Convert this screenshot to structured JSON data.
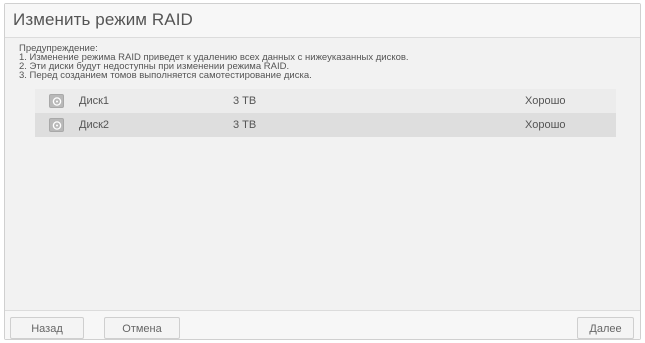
{
  "dialog": {
    "title": "Изменить режим RAID"
  },
  "warning": {
    "heading": "Предупреждение:",
    "lines": [
      "1. Изменение режима RAID приведет к удалению всех данных с нижеуказанных дисков.",
      "2. Эти диски будут недоступны при изменении режима RAID.",
      "3. Перед созданием томов выполняется самотестирование диска."
    ]
  },
  "disks": [
    {
      "name": "Диск1",
      "size": "3 ТВ",
      "status": "Хорошо",
      "icon": "disk-icon"
    },
    {
      "name": "Диск2",
      "size": "3 ТВ",
      "status": "Хорошо",
      "icon": "disk-icon"
    }
  ],
  "footer": {
    "back_label": "Назад",
    "cancel_label": "Отмена",
    "next_label": "Далее"
  },
  "colors": {
    "panel": "#f2f2f2",
    "row_odd": "#ececec",
    "row_even": "#dedede",
    "text": "#555555"
  }
}
